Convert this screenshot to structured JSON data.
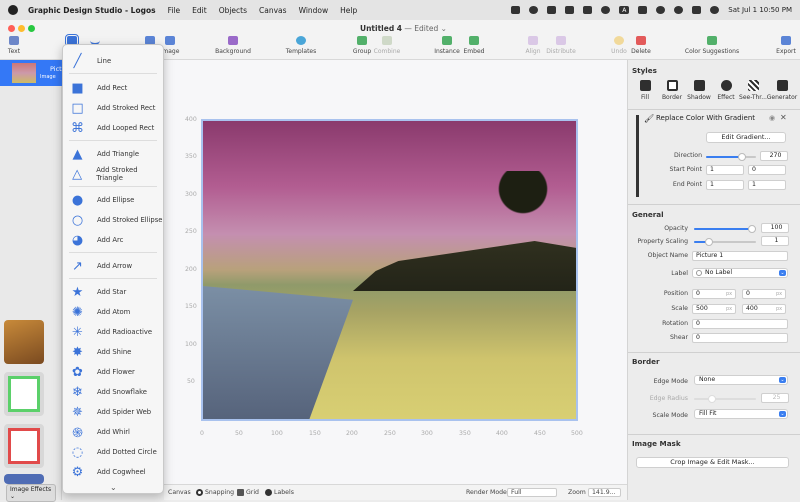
{
  "menubar": {
    "app_name": "Graphic Design Studio - Logos",
    "items": [
      "File",
      "Edit",
      "Objects",
      "Canvas",
      "Window",
      "Help"
    ],
    "clock": "Sat Jul 1  10:50 PM",
    "input_badge": "A"
  },
  "window": {
    "title": "Untitled 4",
    "edited": " — Edited ⌄"
  },
  "toolbar": {
    "text": "Text",
    "image": "Image",
    "background": "Background",
    "templates": "Templates",
    "group": "Group",
    "combine": "Combine",
    "instance": "Instance",
    "embed": "Embed",
    "align": "Align",
    "distribute": "Distribute",
    "undo": "Undo",
    "delete": "Delete",
    "color_suggestions": "Color Suggestions",
    "export": "Export"
  },
  "layers": {
    "name": "Pictu",
    "sub": "Image",
    "effects_label": "Image Effects ⌄"
  },
  "shape_menu": {
    "items": [
      "Line",
      "Add Rect",
      "Add Stroked Rect",
      "Add Looped Rect",
      "Add Triangle",
      "Add Stroked Triangle",
      "Add Ellipse",
      "Add Stroked Ellipse",
      "Add Arc",
      "Add Arrow",
      "Add Star",
      "Add Atom",
      "Add Radioactive",
      "Add Shine",
      "Add Flower",
      "Add Snowflake",
      "Add Spider Web",
      "Add Whirl",
      "Add Dotted Circle",
      "Add Cogwheel"
    ],
    "more": "⌄"
  },
  "ruler": {
    "x": [
      "0",
      "50",
      "100",
      "150",
      "200",
      "250",
      "300",
      "350",
      "400",
      "450",
      "500"
    ],
    "y": [
      "400",
      "350",
      "300",
      "250",
      "200",
      "150",
      "100",
      "50"
    ]
  },
  "bottombar": {
    "canvas": "Canvas",
    "snapping": "Snapping",
    "grid": "Grid",
    "labels": "Labels",
    "render_mode_label": "Render Mode",
    "render_mode_value": "Full",
    "zoom_label": "Zoom",
    "zoom_value": "141.9..."
  },
  "styles": {
    "header": "Styles",
    "tabs": [
      "Fill",
      "Border",
      "Shadow",
      "Effect",
      "See-Thr...",
      "Generator"
    ]
  },
  "effect": {
    "title": "Replace Color With Gradient",
    "edit_button": "Edit Gradient...",
    "direction_label": "Direction",
    "direction_value": "270",
    "direction_fraction": 0.75,
    "start_label": "Start Point",
    "start_x": "1",
    "start_y": "0",
    "end_label": "End Point",
    "end_x": "1",
    "end_y": "1"
  },
  "general": {
    "header": "General",
    "opacity_label": "Opacity",
    "opacity_value": "100",
    "opacity_fraction": 1.0,
    "prop_scaling_label": "Property Scaling",
    "prop_scaling_value": "1",
    "prop_scaling_fraction": 0.2,
    "object_name_label": "Object Name",
    "object_name_value": "Picture 1",
    "label_label": "Label",
    "label_value": "No Label",
    "position_label": "Position",
    "position_x": "0",
    "position_y": "0",
    "scale_label": "Scale",
    "scale_x": "500",
    "scale_y": "400",
    "rotation_label": "Rotation",
    "rotation_value": "0",
    "shear_label": "Shear",
    "shear_value": "0",
    "px_unit": "px"
  },
  "border": {
    "header": "Border",
    "edge_mode_label": "Edge Mode",
    "edge_mode_value": "None",
    "edge_radius_label": "Edge Radius",
    "edge_radius_value": "25",
    "scale_mode_label": "Scale Mode",
    "scale_mode_value": "Fill Fit"
  },
  "image_mask": {
    "header": "Image Mask",
    "button": "Crop Image & Edit Mask..."
  },
  "colors": {
    "accent": "#3478f6",
    "icon_blue": "#3b73d8"
  }
}
